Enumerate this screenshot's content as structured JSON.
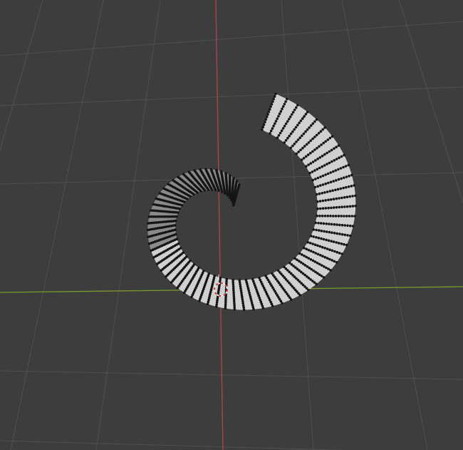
{
  "viewport": {
    "mode": "edit-mode",
    "view": "perspective",
    "colors": {
      "background": "#3d3d3d",
      "grid_line": "#505050",
      "x_axis": "#7a9a2c",
      "z_axis": "#b4434f",
      "mesh_face_light": "#d0d0d0",
      "mesh_face_dark": "#8a8a8a",
      "vertex": "#151515",
      "cursor_red": "#d23b3b",
      "cursor_white": "#eeeeee"
    }
  },
  "mesh": {
    "object": "spiral-strip-mesh",
    "selection": "none"
  },
  "cursor": {
    "icon": "3d-cursor-icon"
  }
}
